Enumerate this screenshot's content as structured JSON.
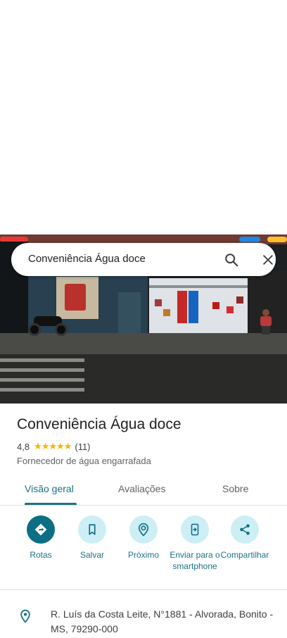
{
  "search": {
    "query": "Conveniência Água doce"
  },
  "place": {
    "name": "Conveniência Água doce",
    "rating": "4,8",
    "stars": "★★★★★",
    "review_count": "(11)",
    "category": "Fornecedor de água engarrafada"
  },
  "tabs": [
    {
      "label": "Visão geral",
      "active": true
    },
    {
      "label": "Avaliações",
      "active": false
    },
    {
      "label": "Sobre",
      "active": false
    }
  ],
  "actions": [
    {
      "label": "Rotas",
      "icon": "directions-icon"
    },
    {
      "label": "Salvar",
      "icon": "bookmark-icon"
    },
    {
      "label": "Próximo",
      "icon": "nearby-icon"
    },
    {
      "label": "Enviar para o smartphone",
      "icon": "send-to-phone-icon"
    },
    {
      "label": "Compartilhar",
      "icon": "share-icon"
    }
  ],
  "address": {
    "text": "R. Luís da Costa Leite, N°1881 - Alvorada, Bonito - MS, 79290-000",
    "icon": "location-pin-icon"
  },
  "colors": {
    "accent": "#1a7385",
    "primary_button": "#0c6f84",
    "action_circle": "#cdeef5",
    "star": "#f4b400"
  }
}
